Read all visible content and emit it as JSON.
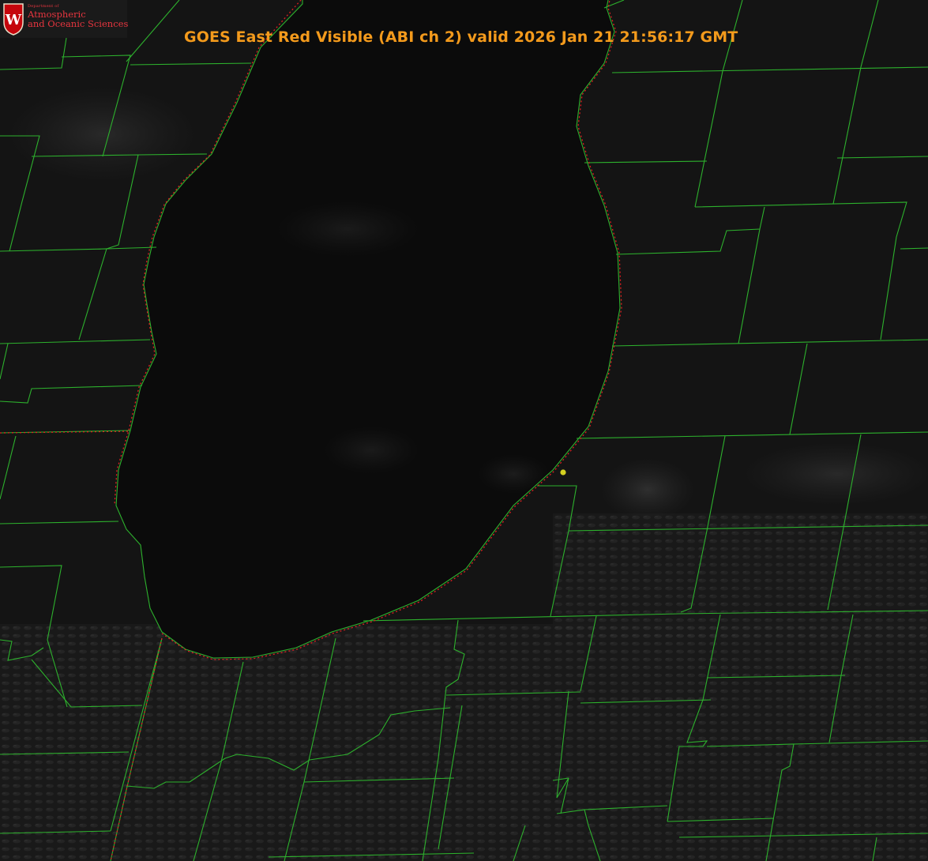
{
  "title": "GOES East Red Visible (ABI ch 2) valid 2026 Jan 21 21:56:17 GMT",
  "logo": {
    "department": "Department of",
    "line1": "Atmospheric",
    "line2": "and Oceanic Sciences",
    "seal_letter": "W"
  },
  "colors": {
    "background": "#101010",
    "lake": "#0a0a0a",
    "county_lines": "#2db12d",
    "state_boundary": "#e02020",
    "title": "#f39a1c",
    "marker": "#d4d021",
    "logo_text": "#e8353f"
  },
  "map": {
    "features": [
      "county-boundaries",
      "state-boundary",
      "lake-michigan-shoreline",
      "location-marker"
    ]
  }
}
